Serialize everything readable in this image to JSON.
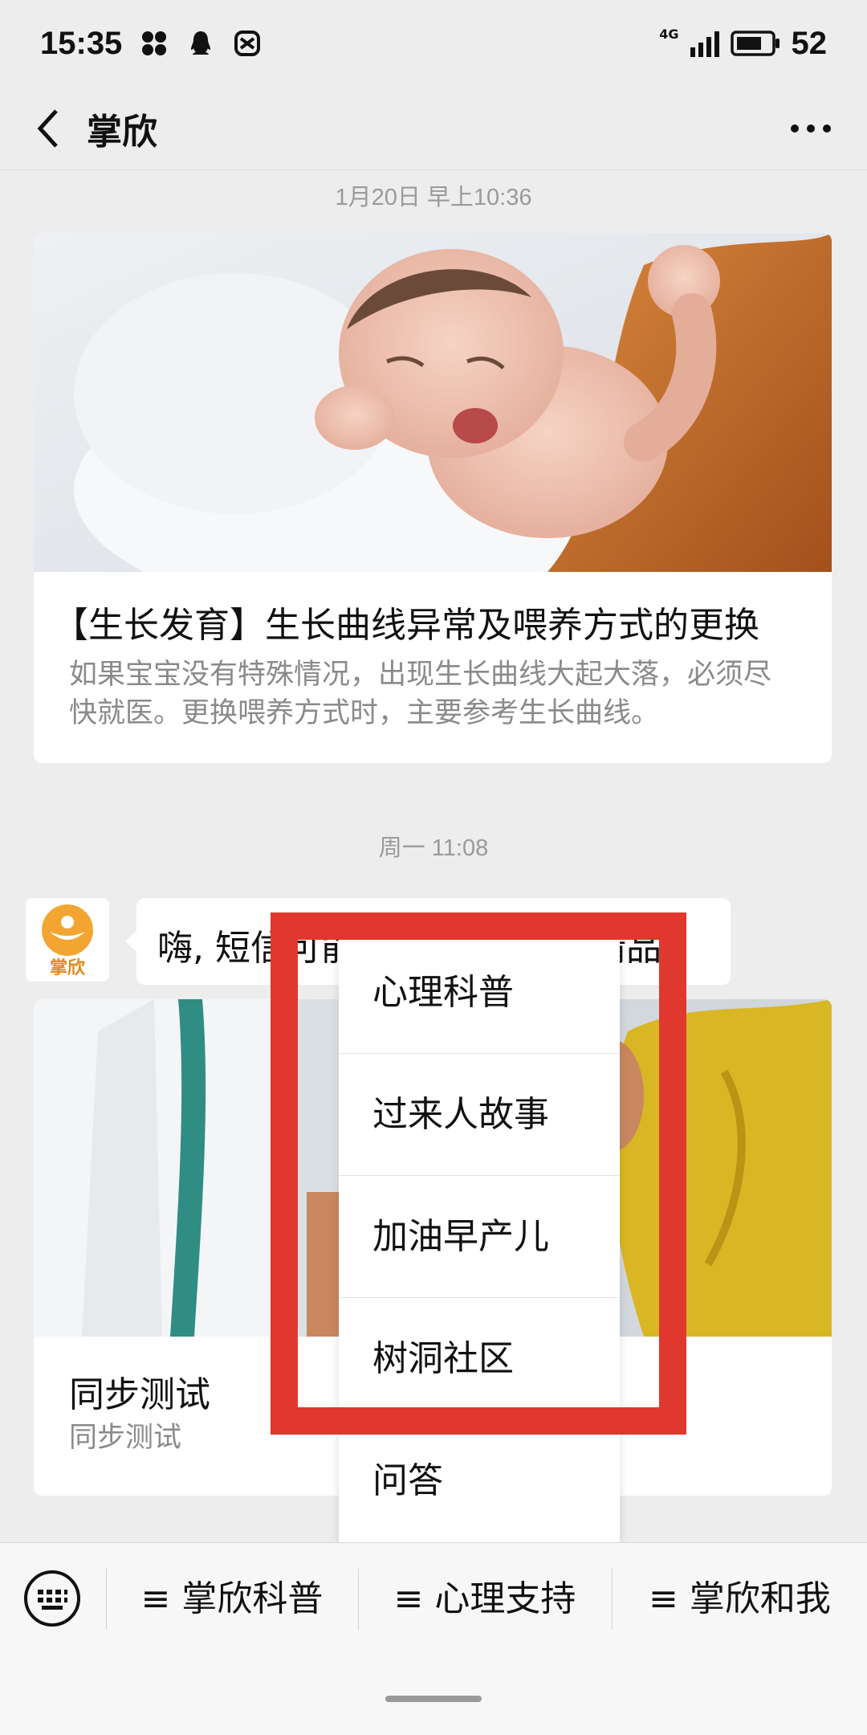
{
  "status_bar": {
    "time": "15:35",
    "network": "4G",
    "battery": "52"
  },
  "nav": {
    "title": "掌欣"
  },
  "messages": {
    "timestamp_1": "1月20日 早上10:36",
    "article_1": {
      "title": "【生长发育】生长曲线异常及喂养方式的更换",
      "desc": "如果宝宝没有特殊情况，出现生长曲线大起大落，必须尽快就医。更换喂养方式时，主要参考生长曲线。"
    },
    "timestamp_2": "周一 11:08",
    "avatar_text": "掌欣",
    "bubble_text": "嗨, 短信可能会导致阅读, 请精品",
    "article_2": {
      "title": "同步测试",
      "desc": "同步测试"
    }
  },
  "popup_menu": {
    "items": [
      "心理科普",
      "过来人故事",
      "加油早产儿",
      "树洞社区",
      "问答"
    ]
  },
  "bottom_menu": {
    "tabs": [
      "≡ 掌欣科普",
      "≡ 心理支持",
      "≡ 掌欣和我"
    ]
  },
  "colors": {
    "highlight": "#e0372f",
    "brand_orange": "#f2a531"
  }
}
